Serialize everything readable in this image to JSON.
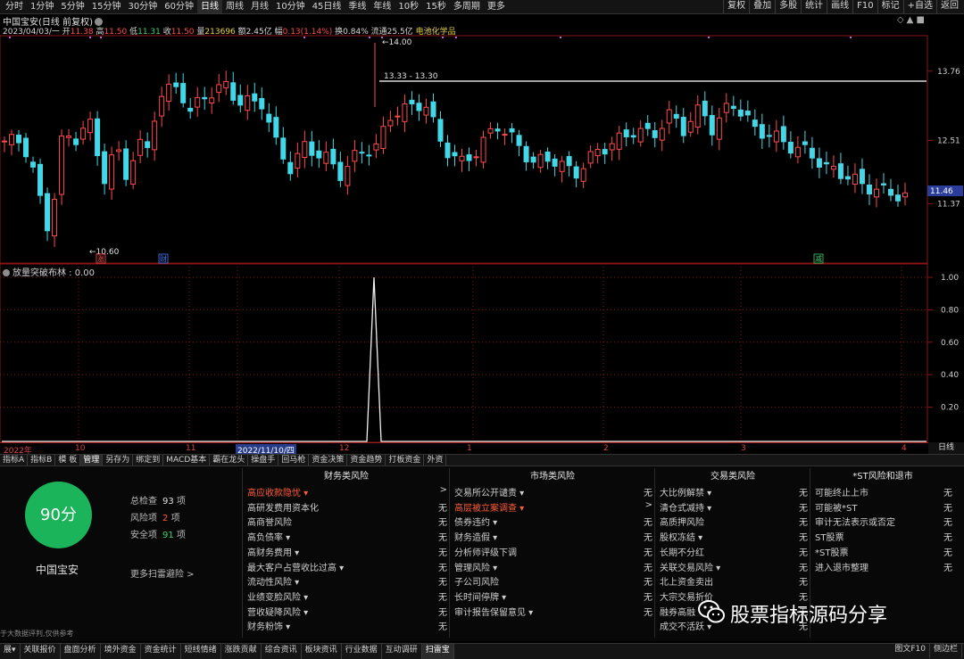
{
  "toolbar": {
    "periods": [
      "分时",
      "1分钟",
      "5分钟",
      "15分钟",
      "30分钟",
      "60分钟",
      "日线",
      "周线",
      "月线",
      "10分钟",
      "45日线",
      "季线",
      "年线",
      "10秒",
      "15秒",
      "多周期",
      "更多"
    ],
    "active_period": 6,
    "right_buttons": [
      "复权",
      "叠加",
      "多股",
      "统计",
      "画线",
      "F10",
      "标记",
      "+自选",
      "返回"
    ]
  },
  "header": {
    "title": "中国宝安(日线 前复权)",
    "date": "2023/04/03/一",
    "open_label": "开",
    "open": "11.38",
    "high_label": "高",
    "high": "11.50",
    "low_label": "低",
    "low": "11.31",
    "close_label": "收",
    "close": "11.50",
    "volume_label": "量",
    "volume": "213696",
    "amount_label": "额",
    "amount": "2.45亿",
    "change_label": "幅",
    "change": "0.13(1.14%)",
    "turnover_label": "换",
    "turnover": "0.84%",
    "float_label": "流通",
    "float": "25.5亿",
    "sector": "电池化学品",
    "controls": "◇ ▲ ■"
  },
  "main_chart": {
    "price_ticks": [
      13.76,
      12.51,
      11.37
    ],
    "current_price": "11.46",
    "ymin": 10.3,
    "ymax": 14.4,
    "resistance_label": "13.33 - 13.30",
    "resistance_value": 13.3,
    "high_mark": "14.00",
    "low_mark": "10.60",
    "markers": [
      {
        "text": "涨",
        "color": "#ff4b4b"
      },
      {
        "text": "财",
        "color": "#4a7dff"
      },
      {
        "text": "减",
        "color": "#3fd36d"
      }
    ]
  },
  "sub_chart": {
    "title": "放量突破布林 : 0.00",
    "ticks": [
      "1.00",
      "0.80",
      "0.60",
      "0.40",
      "0.20"
    ],
    "spike_index": 42,
    "spike_value": 1.0
  },
  "date_axis": {
    "labels": [
      "2022年",
      "10",
      "11",
      "2022/11/10/四",
      "12",
      "1",
      "2",
      "3",
      "4"
    ],
    "period_label": "日线"
  },
  "tabs": [
    "指标A",
    "指标B",
    "模 板",
    "管理",
    "另存为",
    "绑定到",
    "MACD基本",
    "霸在龙头",
    "操盘手",
    "回马枪",
    "资金决策",
    "资金趋势",
    "打板资金",
    "外资"
  ],
  "active_tab": 3,
  "scan": {
    "score": "90分",
    "stock_name": "中国宝安",
    "total_label": "总检查",
    "total": "93",
    "total_unit": "项",
    "risk_label": "风险项",
    "risk": "2",
    "risk_unit": "项",
    "safe_label": "安全项",
    "safe": "91",
    "safe_unit": "项",
    "more": "更多扫雷避险 >",
    "disclaimer": "于大数据评判,仅供参考"
  },
  "risk_columns": [
    {
      "title": "财务类风险",
      "rows": [
        {
          "name": "高应收款隐忧 ▾",
          "val": ">",
          "hi": true
        },
        {
          "name": "高研发费用资本化",
          "val": "无"
        },
        {
          "name": "高商誉风险",
          "val": "无"
        },
        {
          "name": "高负债率 ▾",
          "val": "无"
        },
        {
          "name": "高财务费用 ▾",
          "val": "无"
        },
        {
          "name": "最大客户占营收比过高 ▾",
          "val": "无"
        },
        {
          "name": "流动性风险 ▾",
          "val": "无"
        },
        {
          "name": "业绩变脸风险 ▾",
          "val": "无"
        },
        {
          "name": "营收疑降风险 ▾",
          "val": "无"
        },
        {
          "name": "财务粉饰 ▾",
          "val": "无"
        }
      ]
    },
    {
      "title": "市场类风险",
      "rows": [
        {
          "name": "交易所公开谴责 ▾",
          "val": "无"
        },
        {
          "name": "高层被立案调查 ▾",
          "val": ">",
          "hi": true
        },
        {
          "name": "债券违约 ▾",
          "val": "无"
        },
        {
          "name": "财务造假 ▾",
          "val": "无"
        },
        {
          "name": "分析师评级下调",
          "val": "无"
        },
        {
          "name": "管理风险 ▾",
          "val": "无"
        },
        {
          "name": "子公司风险",
          "val": "无"
        },
        {
          "name": "长时间停牌 ▾",
          "val": "无"
        },
        {
          "name": "审计报告保留意见 ▾",
          "val": "无"
        }
      ]
    },
    {
      "title": "交易类风险",
      "rows": [
        {
          "name": "大比例解禁 ▾",
          "val": "无"
        },
        {
          "name": "清仓式减持 ▾",
          "val": "无"
        },
        {
          "name": "高质押风险",
          "val": "无"
        },
        {
          "name": "股权冻结 ▾",
          "val": "无"
        },
        {
          "name": "长期不分红",
          "val": "无"
        },
        {
          "name": "关联交易风险 ▾",
          "val": "无"
        },
        {
          "name": "北上资金卖出",
          "val": "无"
        },
        {
          "name": "大宗交易折价",
          "val": "无"
        },
        {
          "name": "融券高融",
          "val": "无"
        },
        {
          "name": "成交不活跃 ▾",
          "val": "无"
        }
      ]
    },
    {
      "title": "*ST风险和退市",
      "rows": [
        {
          "name": "可能终止上市",
          "val": "无"
        },
        {
          "name": "可能被*ST",
          "val": "无"
        },
        {
          "name": "审计无法表示或否定",
          "val": "无"
        },
        {
          "name": "ST股票",
          "val": "无"
        },
        {
          "name": "*ST股票",
          "val": "无"
        },
        {
          "name": "进入退市整理",
          "val": "无"
        }
      ]
    }
  ],
  "watermark": "股票指标源码分享",
  "bottom_tabs": [
    "展▾",
    "关联报价",
    "盘面分析",
    "境外资金",
    "资金统计",
    "短线情绪",
    "涨跌贡献",
    "综合资讯",
    "板块资讯",
    "行业数据",
    "互动调研",
    "扫雷宝"
  ],
  "active_bottom_tab": 11,
  "bottom_right": [
    "图文F10",
    "侧边栏"
  ],
  "colors": {
    "up": "#ff4b4b",
    "down": "#43d7e7",
    "score_bg": "#1bb45a",
    "grid": "#8a1414"
  }
}
